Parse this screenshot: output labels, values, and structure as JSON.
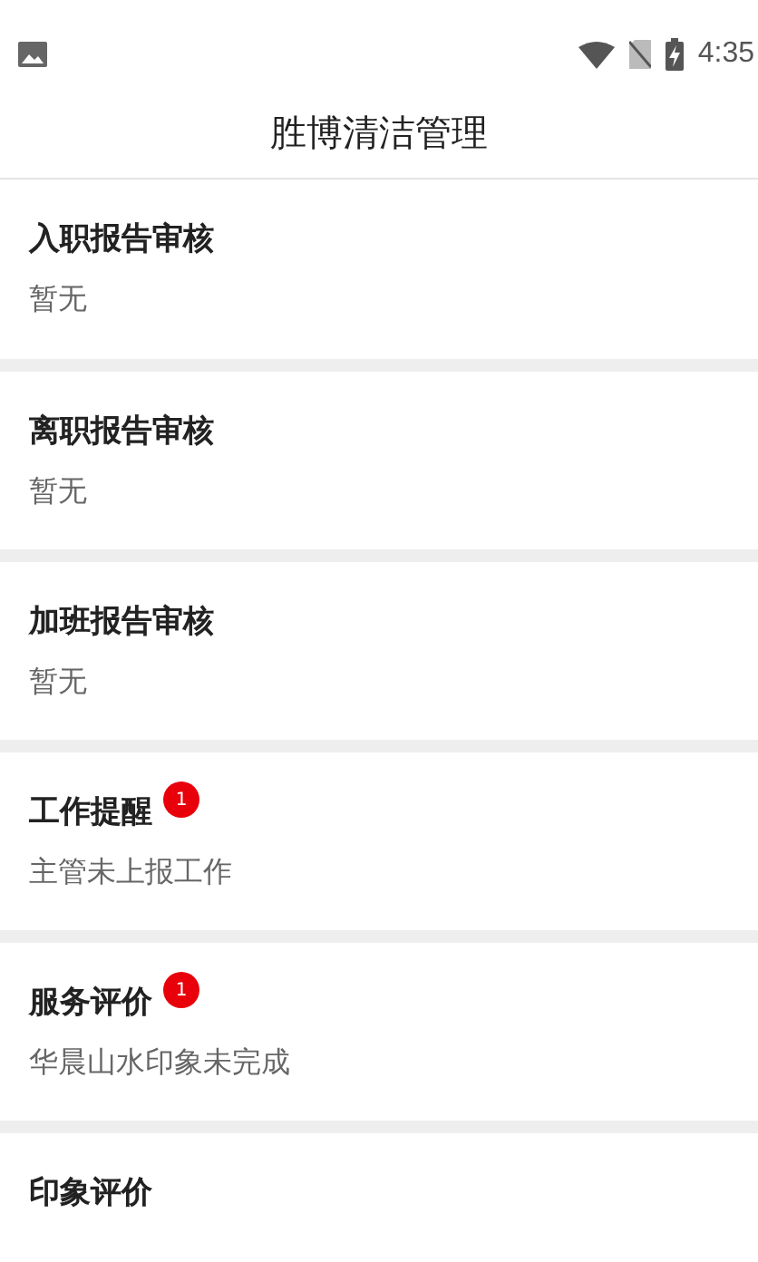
{
  "status_bar": {
    "time": "4:35"
  },
  "title": "胜博清洁管理",
  "items": [
    {
      "title": "入职报告审核",
      "subtitle": "暂无"
    },
    {
      "title": "离职报告审核",
      "subtitle": "暂无"
    },
    {
      "title": "加班报告审核",
      "subtitle": "暂无"
    },
    {
      "title": "工作提醒",
      "badge": "1",
      "subtitle": "主管未上报工作"
    },
    {
      "title": "服务评价",
      "badge": "1",
      "subtitle": "华晨山水印象未完成"
    },
    {
      "title": "印象评价"
    }
  ]
}
